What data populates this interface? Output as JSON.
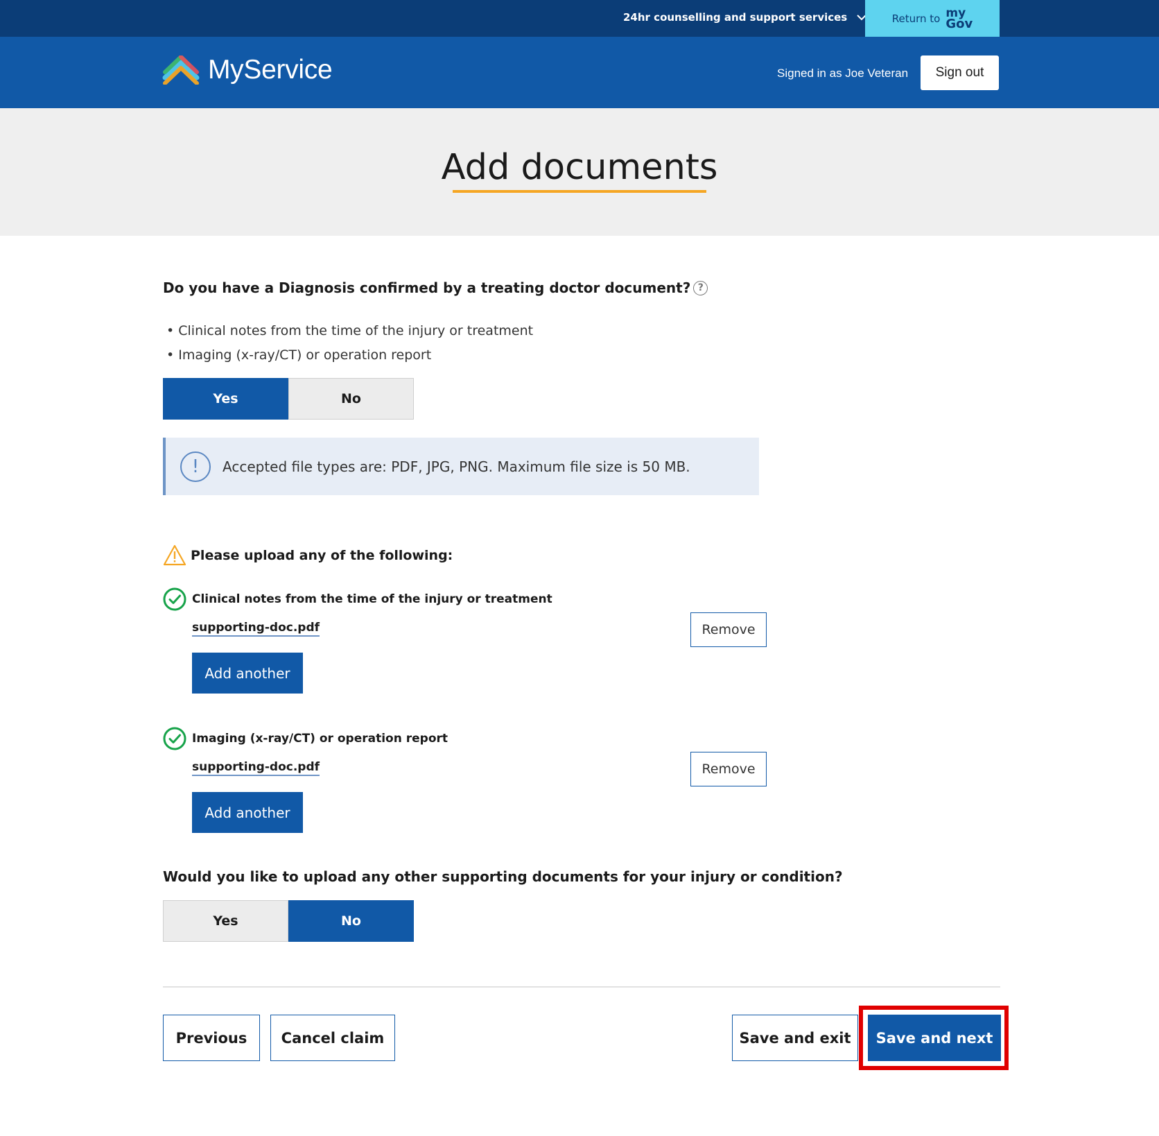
{
  "utility": {
    "support_label": "24hr counselling and support services",
    "return_label": "Return to",
    "mygov_my": "my",
    "mygov_gov": "Gov"
  },
  "header": {
    "brand": "MyService",
    "signed_in": "Signed in as Joe Veteran",
    "sign_out": "Sign out"
  },
  "page": {
    "title": "Add documents"
  },
  "question1": {
    "title": "Do you have a Diagnosis confirmed by a treating doctor document?",
    "bullets": [
      "Clinical notes from the time of the injury or treatment",
      "Imaging (x-ray/CT) or operation report"
    ],
    "yes": "Yes",
    "no": "No",
    "selected": "Yes"
  },
  "info": {
    "text": "Accepted file types are: PDF, JPG, PNG. Maximum file size is 50 MB."
  },
  "upload": {
    "heading": "Please upload any of the following:",
    "docs": [
      {
        "title": "Clinical notes from the time of the injury or treatment",
        "file": "supporting-doc.pdf",
        "remove": "Remove",
        "add": "Add another"
      },
      {
        "title": "Imaging (x-ray/CT) or operation report",
        "file": "supporting-doc.pdf",
        "remove": "Remove",
        "add": "Add another"
      }
    ]
  },
  "question2": {
    "title": "Would you like to upload any other supporting documents for your injury or condition?",
    "yes": "Yes",
    "no": "No",
    "selected": "No"
  },
  "footer": {
    "previous": "Previous",
    "cancel": "Cancel claim",
    "save_exit": "Save and exit",
    "save_next": "Save and next"
  },
  "colors": {
    "utility_bar": "#0b3d77",
    "header": "#1159a7",
    "mygov": "#5ed3ef",
    "accent_underline": "#f5a623",
    "success": "#17a34a",
    "warning": "#f5a623",
    "highlight": "#e00000"
  },
  "icons": {
    "support_chevron": "chevron-down-icon",
    "help": "question-circle-icon",
    "info": "exclamation-circle-icon",
    "warning": "warning-triangle-icon",
    "check": "check-circle-icon"
  }
}
